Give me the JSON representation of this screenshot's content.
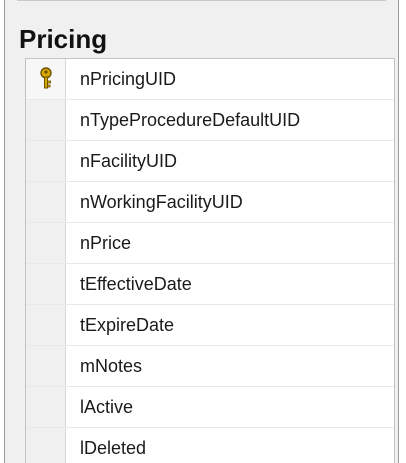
{
  "table": {
    "title": "Pricing",
    "columns": [
      {
        "name": "nPricingUID",
        "primary_key": true,
        "icon": "key-icon"
      },
      {
        "name": "nTypeProcedureDefaultUID",
        "primary_key": false
      },
      {
        "name": "nFacilityUID",
        "primary_key": false
      },
      {
        "name": "nWorkingFacilityUID",
        "primary_key": false
      },
      {
        "name": "nPrice",
        "primary_key": false
      },
      {
        "name": "tEffectiveDate",
        "primary_key": false
      },
      {
        "name": "tExpireDate",
        "primary_key": false
      },
      {
        "name": "mNotes",
        "primary_key": false
      },
      {
        "name": "lActive",
        "primary_key": false
      },
      {
        "name": "lDeleted",
        "primary_key": false
      }
    ]
  },
  "colors": {
    "key_icon": "#d4a800",
    "key_icon_outline": "#6b5200"
  }
}
